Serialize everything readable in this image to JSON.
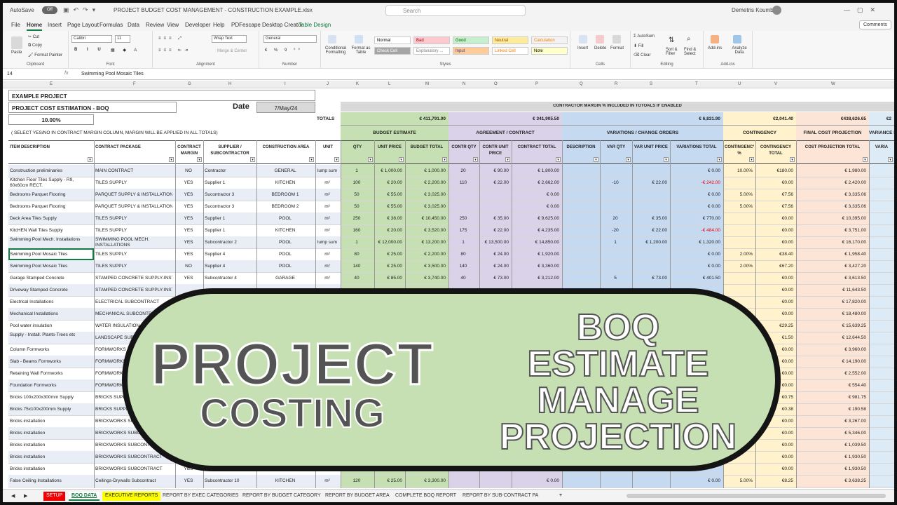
{
  "titlebar": {
    "autosave": "AutoSave",
    "toggle": "Off",
    "filename": "PROJECT BUDGET COST MANAGEMENT - CONSTRUCTION EXAMPLE.xlsx",
    "search_placeholder": "Search",
    "user": "Demetris Koumbas"
  },
  "menu": [
    "File",
    "Home",
    "Insert",
    "Page Layout",
    "Formulas",
    "Data",
    "Review",
    "View",
    "Developer",
    "Help",
    "PDFescape Desktop Creator",
    "Table Design"
  ],
  "comments": "Comments",
  "ribbon": {
    "clipboard": {
      "paste": "Paste",
      "cut": "Cut",
      "copy": "Copy",
      "format_painter": "Format Painter",
      "label": "Clipboard"
    },
    "font": {
      "name": "Calibri",
      "size": "11",
      "label": "Font"
    },
    "alignment": {
      "wrap": "Wrap Text",
      "merge": "Merge & Center",
      "label": "Alignment"
    },
    "number": {
      "format": "General",
      "label": "Number"
    },
    "styles": {
      "cond": "Conditional Formatting",
      "table": "Format as Table",
      "cells": [
        {
          "label": "Normal",
          "bg": "#ffffff",
          "fg": "#000000"
        },
        {
          "label": "Bad",
          "bg": "#ffc7ce",
          "fg": "#9c0006"
        },
        {
          "label": "Good",
          "bg": "#c6efce",
          "fg": "#006100"
        },
        {
          "label": "Neutral",
          "bg": "#ffeb9c",
          "fg": "#9c5700"
        },
        {
          "label": "Calculation",
          "bg": "#f2f2f2",
          "fg": "#fa7d00"
        },
        {
          "label": "Check Cell",
          "bg": "#a5a5a5",
          "fg": "#ffffff"
        },
        {
          "label": "Explanatory ...",
          "bg": "#ffffff",
          "fg": "#7f7f7f"
        },
        {
          "label": "Input",
          "bg": "#ffcc99",
          "fg": "#3f3f76"
        },
        {
          "label": "Linked Cell",
          "bg": "#ffffff",
          "fg": "#fa7d00"
        },
        {
          "label": "Note",
          "bg": "#ffffcc",
          "fg": "#000000"
        }
      ],
      "label": "Styles"
    },
    "cells": {
      "insert": "Insert",
      "delete": "Delete",
      "format": "Format",
      "label": "Cells"
    },
    "editing": {
      "autosum": "AutoSum",
      "fill": "Fill",
      "clear": "Clear",
      "sort": "Sort & Filter",
      "find": "Find & Select",
      "label": "Editing"
    },
    "addins": {
      "addins": "Add-ins",
      "analyze": "Analyze Data",
      "label": "Add-ins"
    }
  },
  "formula_bar": {
    "namebox": "14",
    "fx": "fx",
    "value": "Swimming Pool Mosaic Tiles"
  },
  "columns": [
    "E",
    "F",
    "G",
    "H",
    "I",
    "J",
    "K",
    "L",
    "M",
    "N",
    "O",
    "P",
    "Q",
    "R",
    "S",
    "T",
    "U",
    "V",
    "W"
  ],
  "sheet": {
    "example_project": "EXAMPLE PROJECT",
    "project_title": "PROJECT COST ESTIMATION - BOQ",
    "date_label": "Date",
    "date_value": "7/May/24",
    "margin_pct": "10.00%",
    "margin_note": "( SELECT YES/NO IN CONTRACT MARGIN COLUMN, MARGIN WILL BE APPLIED IN ALL TOTALS)",
    "totals_label": "TOTALS",
    "contractor_margin_note": "CONTRACTOR MARGIN % INCLUDED IN TOTOALS IF ENABLED",
    "totals": {
      "budget": "€ 411,791.00",
      "contract": "€ 341,905.50",
      "variations": "€ 6,831.90",
      "contingency": "€2,041.40",
      "final": "€438,626.65",
      "variance": "€2"
    },
    "sections": {
      "budget": "BUDGET ESTIMATE",
      "contract": "AGREEMENT / CONTRACT",
      "variations": "VARIATIONS / CHANGE ORDERS",
      "contingency": "CONTINGENCY",
      "final": "FINAL COST PROJECTION",
      "variance": "VARIANCE B"
    },
    "headers": [
      "ITEM DESCRIPTION",
      "CONTRACT PACKAGE",
      "CONTRACT MARGIN",
      "SUPPLIER / SUBCONTRACTOR",
      "CONSTRUCTION AREA",
      "UNIT",
      "QTY",
      "UNIT PRICE",
      "BUDGET TOTAL",
      "CONTR QTY",
      "CONTR UNIT PRICE",
      "CONTRACT TOTAL",
      "DESCRIPTION",
      "VAR QTY",
      "VAR UNIT PRICE",
      "VARIATIONS TOTAL",
      "CONTINGENCY %",
      "CONTINGENCY TOTAL",
      "COST PROJECTION TOTAL",
      "VARIA"
    ],
    "rows": [
      [
        "Construction preliminaries",
        "MAIN CONTRACT",
        "NO",
        "Contractor",
        "GENERAL",
        "lump sum",
        "1",
        "€ 1,000.00",
        "€ 1,000.00",
        "20",
        "€ 90.00",
        "€ 1,800.00",
        "",
        "",
        "",
        "€ 0.00",
        "10.00%",
        "€180.00",
        "€ 1,980.00"
      ],
      [
        "Kitchen Floor Tiles Supply - R9, 60x60cm RECT.",
        "TILES SUPPLY",
        "YES",
        "Supplier 1",
        "KITCHEN",
        "m²",
        "100",
        "€ 20.00",
        "€ 2,200.00",
        "110",
        "€ 22.00",
        "€ 2,662.00",
        "",
        "-10",
        "€ 22.00",
        "-€ 242.00",
        "",
        "€0.00",
        "€ 2,420.00"
      ],
      [
        "Bedrooms Parquet Flooring",
        "PARQUET SUPPLY & INSTALLATION",
        "YES",
        "Sucontractor 3",
        "BEDROOM 1",
        "m²",
        "50",
        "€ 55.00",
        "€ 3,025.00",
        "",
        "",
        "€ 0.00",
        "",
        "",
        "",
        "€ 0.00",
        "5.00%",
        "€7.56",
        "€ 3,335.06"
      ],
      [
        "Bedrooms Parquet Flooring",
        "PARQUET SUPPLY & INSTALLATION",
        "YES",
        "Sucontractor 3",
        "BEDROOM 2",
        "m²",
        "50",
        "€ 55.00",
        "€ 3,025.00",
        "",
        "",
        "€ 0.00",
        "",
        "",
        "",
        "€ 0.00",
        "5.00%",
        "€7.56",
        "€ 3,335.06"
      ],
      [
        "Deck Area Tiles Supply",
        "TILES SUPPLY",
        "YES",
        "Supplier 1",
        "POOL",
        "m²",
        "250",
        "€ 38.00",
        "€ 10,450.00",
        "250",
        "€ 35.00",
        "€ 9,625.00",
        "",
        "20",
        "€ 35.00",
        "€ 770.00",
        "",
        "€0.00",
        "€ 10,395.00"
      ],
      [
        "KitcHEN Wall Tiles Supply",
        "TILES SUPPLY",
        "YES",
        "Supplier 1",
        "KITCHEN",
        "m²",
        "160",
        "€ 20.00",
        "€ 3,520.00",
        "175",
        "€ 22.00",
        "€ 4,235.00",
        "",
        "-20",
        "€ 22.00",
        "-€ 484.00",
        "",
        "€0.00",
        "€ 3,751.00"
      ],
      [
        "Swimming Pool Mech. Installations",
        "SWIMMING POOL MECH. INSTALLATIONS",
        "YES",
        "Subcontractor 2",
        "POOL",
        "lump sum",
        "1",
        "€ 12,000.00",
        "€ 13,200.00",
        "1",
        "€ 13,500.00",
        "€ 14,850.00",
        "",
        "1",
        "€ 1,200.00",
        "€ 1,320.00",
        "",
        "€0.00",
        "€ 16,170.00"
      ],
      [
        "Swimming Pool Mosaic Tiles",
        "TILES SUPPLY",
        "YES",
        "Supplier 4",
        "POOL",
        "m²",
        "80",
        "€ 25.00",
        "€ 2,200.00",
        "80",
        "€ 24.00",
        "€ 1,920.00",
        "",
        "",
        "",
        "€ 0.00",
        "2.00%",
        "€38.40",
        "€ 1,958.40"
      ],
      [
        "Swimming Pool Mosaic Tiles",
        "TILES SUPPLY",
        "NO",
        "Supplier 4",
        "POOL",
        "m²",
        "140",
        "€ 25.00",
        "€ 3,500.00",
        "140",
        "€ 24.00",
        "€ 3,360.00",
        "",
        "",
        "",
        "€ 0.00",
        "2.00%",
        "€67.20",
        "€ 3,427.20"
      ],
      [
        "Garage Stamped Concrete",
        "STAMPED CONCRETE SUPPLY-INST.",
        "YES",
        "Subcontractor 4",
        "GARAGE",
        "m²",
        "40",
        "€ 85.00",
        "€ 3,740.00",
        "40",
        "€ 73.00",
        "€ 3,212.00",
        "",
        "5",
        "€ 73.00",
        "€ 401.50",
        "",
        "€0.00",
        "€ 3,613.50"
      ],
      [
        "Driveway Stamped Concrete",
        "STAMPED CONCRETE SUPPLY-INST.",
        "",
        "",
        "",
        "",
        "",
        "",
        "",
        "",
        "",
        "",
        "",
        "",
        "",
        "",
        "",
        "€0.00",
        "€ 11,643.50"
      ],
      [
        "Electrical Installations",
        "ELECTRICAL SUBCONTRACT",
        "",
        "",
        "",
        "",
        "",
        "",
        "",
        "",
        "",
        "",
        "",
        "",
        "",
        "",
        "",
        "€0.00",
        "€ 17,820.00"
      ],
      [
        "Mechanical Installations",
        "MECHANICAL SUBCONTRACT",
        "",
        "",
        "",
        "",
        "",
        "",
        "",
        "",
        "",
        "",
        "",
        "",
        "",
        "",
        "",
        "€0.00",
        "€ 18,480.00"
      ],
      [
        "Pool water insulation",
        "WATER INSULATION",
        "",
        "",
        "",
        "",
        "",
        "",
        "",
        "",
        "",
        "",
        "",
        "",
        "",
        "",
        "",
        "€29.25",
        "€ 15,639.25"
      ],
      [
        "Supply - Install. Plants-Trees etc",
        "LANDSCAPE SUBCONTRACT",
        "",
        "",
        "",
        "",
        "",
        "",
        "",
        "",
        "",
        "",
        "",
        "",
        "",
        "",
        "",
        "€1.50",
        "€ 12,644.50"
      ],
      [
        "Column Formworks",
        "FORMWORKS",
        "",
        "",
        "",
        "",
        "",
        "",
        "",
        "",
        "",
        "",
        "",
        "",
        "",
        "",
        "",
        "€0.00",
        "€ 3,960.00"
      ],
      [
        "Slab - Beams Formworks",
        "FORMWORKS",
        "",
        "",
        "",
        "",
        "",
        "",
        "",
        "",
        "",
        "",
        "",
        "",
        "",
        "",
        "",
        "€0.00",
        "€ 14,190.00"
      ],
      [
        "Retaining Wall Formworks",
        "FORMWORKS",
        "",
        "",
        "",
        "",
        "",
        "",
        "",
        "",
        "",
        "",
        "",
        "",
        "",
        "",
        "",
        "€0.00",
        "€ 2,552.00"
      ],
      [
        "Foundation Formworks",
        "FORMWORKS",
        "",
        "",
        "",
        "",
        "",
        "",
        "",
        "",
        "",
        "",
        "",
        "",
        "",
        "",
        "",
        "€0.00",
        "€ 554.40"
      ],
      [
        "Bricks 100x200x300mm Supply",
        "BRICKS SUPPLY",
        "",
        "",
        "",
        "",
        "",
        "",
        "",
        "",
        "",
        "",
        "",
        "",
        "",
        "",
        "",
        "€0.75",
        "€ 981.75"
      ],
      [
        "Bricks 75x100x200mm Supply",
        "BRICKS SUPPLY",
        "",
        "",
        "",
        "",
        "",
        "",
        "",
        "",
        "",
        "",
        "",
        "",
        "",
        "",
        "",
        "€0.38",
        "€ 190.58"
      ],
      [
        "Bricks installation",
        "BRICKWORKS SUBCONTRACT",
        "",
        "",
        "",
        "",
        "",
        "",
        "",
        "",
        "",
        "",
        "",
        "",
        "",
        "",
        "",
        "€0.00",
        "€ 3,267.00"
      ],
      [
        "Bricks installation",
        "BRICKWORKS SUBCONTRACT",
        "",
        "",
        "",
        "",
        "",
        "",
        "",
        "",
        "",
        "",
        "",
        "",
        "",
        "",
        "",
        "€0.00",
        "€ 5,346.00"
      ],
      [
        "Bricks installation",
        "BRICKWORKS SUBCONTRACT",
        "",
        "",
        "",
        "",
        "",
        "",
        "",
        "",
        "",
        "",
        "",
        "",
        "",
        "",
        "",
        "€0.00",
        "€ 1,039.50"
      ],
      [
        "Bricks installation",
        "BRICKWORKS SUBCONTRACT",
        "",
        "",
        "",
        "",
        "",
        "",
        "",
        "",
        "",
        "",
        "",
        "",
        "",
        "",
        "",
        "€0.00",
        "€ 1,930.50"
      ],
      [
        "Bricks installation",
        "BRICKWORKS SUBCONTRACT",
        "YES",
        "Subcontractor 5",
        "BEDROOM 2",
        "m²",
        "",
        "€ 27.00",
        "",
        "",
        "€ 27.00",
        "€ 1,782.00",
        "",
        "",
        "€ 27.00",
        "",
        "",
        "€0.00",
        "€ 1,930.50"
      ],
      [
        "False Ceiling Installations",
        "Ceilings-Drywalls Subcontract",
        "YES",
        "Subcontractor 10",
        "KITCHEN",
        "m²",
        "120",
        "€ 25.00",
        "€ 3,300.00",
        "",
        "",
        "€ 0.00",
        "",
        "",
        "",
        "€ 0.00",
        "5.00%",
        "€8.25",
        "€ 3,638.25"
      ]
    ]
  },
  "sheet_tabs": [
    "SETUP",
    "BOQ DATA",
    "EXECUTIVE REPORTS",
    "REPORT BY EXEC CATEGORIES",
    "REPORT BY BUDGET CATEGORY",
    "REPORT BY BUDGET AREA",
    "COMPLETE BOQ REPORT",
    "REPORT BY SUB-CONTRACT PA"
  ],
  "overlay": {
    "left_title": "PROJECT",
    "left_sub": "COSTING",
    "right_lines": [
      "BOQ",
      "ESTIMATE",
      "MANAGE",
      "PROJECTION"
    ]
  },
  "colors": {
    "excel_green": "#107c41",
    "budget_band": "#c6e0b4",
    "contract_band": "#d9d2e9",
    "variation_band": "#c5d9f1",
    "contingency_band": "#fff2cc",
    "final_band": "#fce4d6",
    "variance_band": "#ddebf7",
    "pill_bg": "#c6e0b4"
  }
}
